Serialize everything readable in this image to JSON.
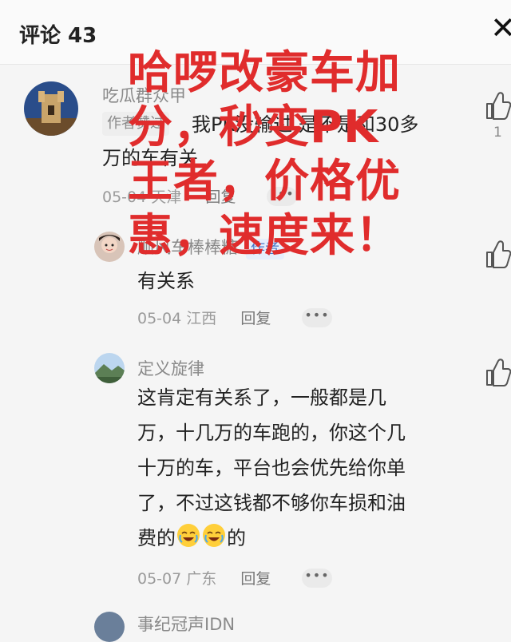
{
  "header": {
    "title": "评论 43",
    "close_glyph": "✕"
  },
  "comments": [
    {
      "name": "吃瓜群众甲",
      "badge": "作者赞过",
      "text1": "我PK没输过 是不是和30多",
      "text2": "万的车有关",
      "date": "05-04",
      "location": "天津",
      "reply": "回复",
      "likes": "1"
    },
    {
      "name": "顺风车棒棒糖",
      "author_tag": "作者",
      "text": "有关系",
      "date": "05-04",
      "location": "江西",
      "reply": "回复"
    },
    {
      "name": "定义旋律",
      "lines": [
        "这肯定有关系了，一般都是几",
        "万，十几万的车跑的，你这个几",
        "十万的车，平台也会优先给你单",
        "了，不过这钱都不够你车损和油"
      ],
      "last_prefix": "费的",
      "last_suffix": "的",
      "date": "05-07",
      "location": "广东",
      "reply": "回复"
    }
  ],
  "overlay": {
    "lines": [
      "哈啰改豪车加",
      "分，秒变PK",
      "王者，价格优",
      "惠，速度来！"
    ],
    "color": "#e02c2c"
  },
  "partial_name": "事纪冠声IDN"
}
